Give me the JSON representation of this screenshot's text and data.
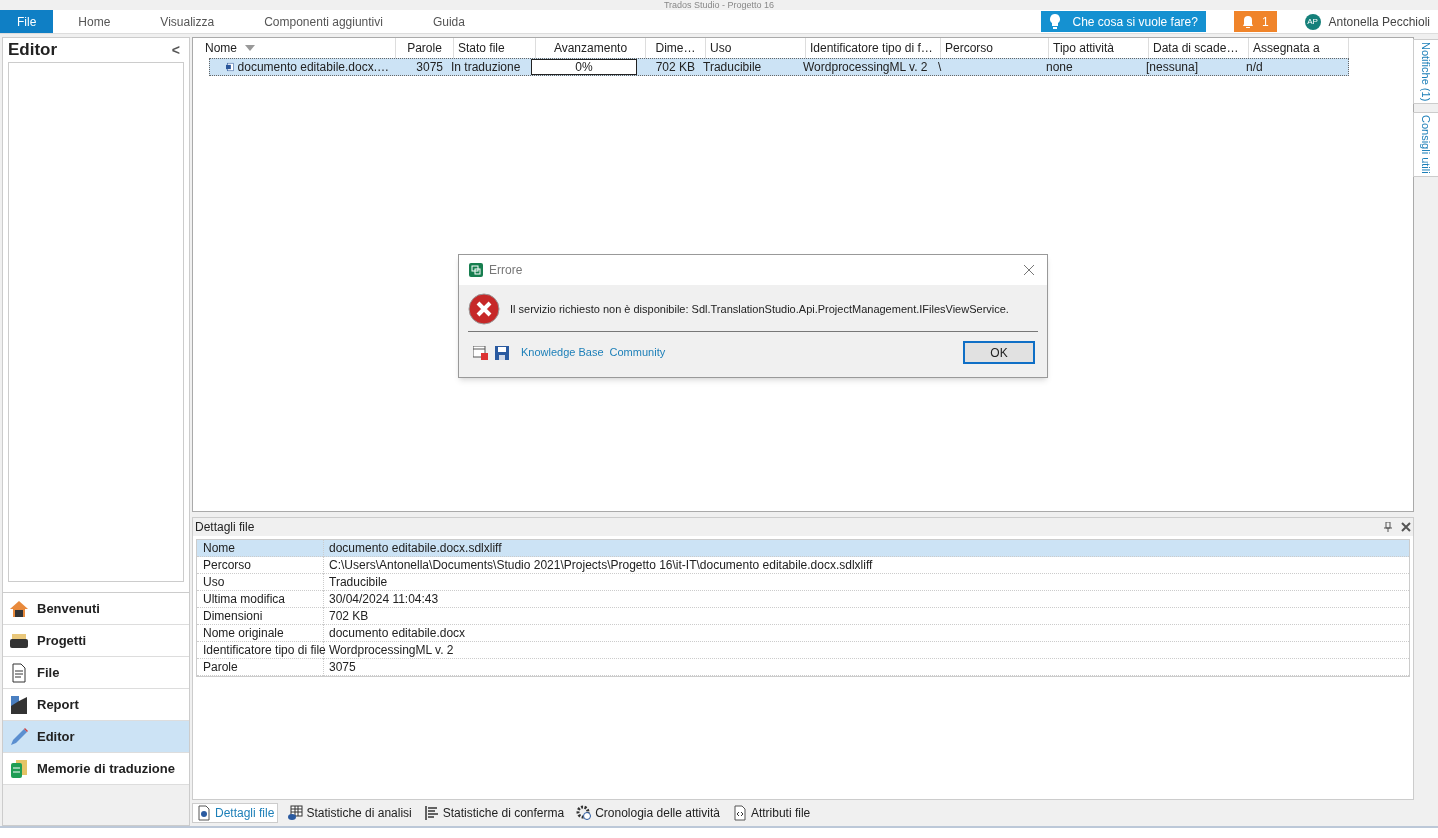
{
  "window": {
    "title": "Trados Studio - Progetto 16"
  },
  "menu": [
    {
      "label": "File",
      "selected": true
    },
    {
      "label": "Home",
      "selected": false
    },
    {
      "label": "Visualizza",
      "selected": false
    },
    {
      "label": "Componenti aggiuntivi",
      "selected": false
    },
    {
      "label": "Guida",
      "selected": false
    }
  ],
  "search_button": "Che cosa si vuole fare?",
  "notifications_button": "1",
  "user": {
    "initials": "AP",
    "name": "Antonella Pecchioli"
  },
  "sidebar": {
    "title": "Editor",
    "collapse": "<",
    "items": [
      {
        "label": "Benvenuti",
        "kind": "home",
        "selected": false
      },
      {
        "label": "Progetti",
        "kind": "projects",
        "selected": false
      },
      {
        "label": "File",
        "kind": "file",
        "selected": false
      },
      {
        "label": "Report",
        "kind": "report",
        "selected": false
      },
      {
        "label": "Editor",
        "kind": "editor",
        "selected": true
      },
      {
        "label": "Memorie di traduzione",
        "kind": "memory",
        "selected": false
      }
    ]
  },
  "files_table": {
    "columns": [
      "Nome",
      "Parole",
      "Stato file",
      "Avanzamento",
      "Dime…",
      "Uso",
      "Identificatore tipo di f…",
      "Percorso",
      "Tipo attività",
      "Data di scade…",
      "Assegnata a"
    ],
    "rows": [
      {
        "selected": true,
        "name": "documento editabile.docx.…",
        "words": "3075",
        "status": "In traduzione",
        "progress": {
          "level": 0,
          "reading": "0%"
        },
        "size": "702 KB",
        "usage": "Traducibile",
        "file_type": "WordprocessingML v. 2",
        "path": "\\",
        "task_type": "none",
        "due_date": "[nessuna]",
        "assigned_to": "n/d"
      }
    ]
  },
  "right_panels": [
    "Notifiche (1)",
    "Consigli utili"
  ],
  "file_details": {
    "title": "Dettagli file",
    "rows": [
      {
        "label": "Nome",
        "value": "documento editabile.docx.sdlxliff",
        "selected": true
      },
      {
        "label": "Percorso",
        "value": "C:\\Users\\Antonella\\Documents\\Studio 2021\\Projects\\Progetto 16\\it-IT\\documento editabile.docx.sdlxliff",
        "selected": false
      },
      {
        "label": "Uso",
        "value": "Traducibile",
        "selected": false
      },
      {
        "label": "Ultima modifica",
        "value": "30/04/2024 11:04:43",
        "selected": false
      },
      {
        "label": "Dimensioni",
        "value": "702 KB",
        "selected": false
      },
      {
        "label": "Nome originale",
        "value": "documento editabile.docx",
        "selected": false
      },
      {
        "label": "Identificatore tipo di file",
        "value": "WordprocessingML v. 2",
        "selected": false
      },
      {
        "label": "Parole",
        "value": "3075",
        "selected": false
      }
    ]
  },
  "bottom_tabs": [
    {
      "label": "Dettagli file",
      "kind": "info",
      "selected": true
    },
    {
      "label": "Statistiche di analisi",
      "kind": "stats",
      "selected": false
    },
    {
      "label": "Statistiche di conferma",
      "kind": "confirm",
      "selected": false
    },
    {
      "label": "Cronologia delle attività",
      "kind": "history",
      "selected": false
    },
    {
      "label": "Attributi file",
      "kind": "attributes",
      "selected": false
    }
  ],
  "dialog": {
    "title": "Errore",
    "message": "Il servizio richiesto non è disponibile: Sdl.TranslationStudio.Api.ProjectManagement.IFilesViewService.",
    "links": [
      "Knowledge Base",
      "Community"
    ],
    "button": "OK"
  }
}
